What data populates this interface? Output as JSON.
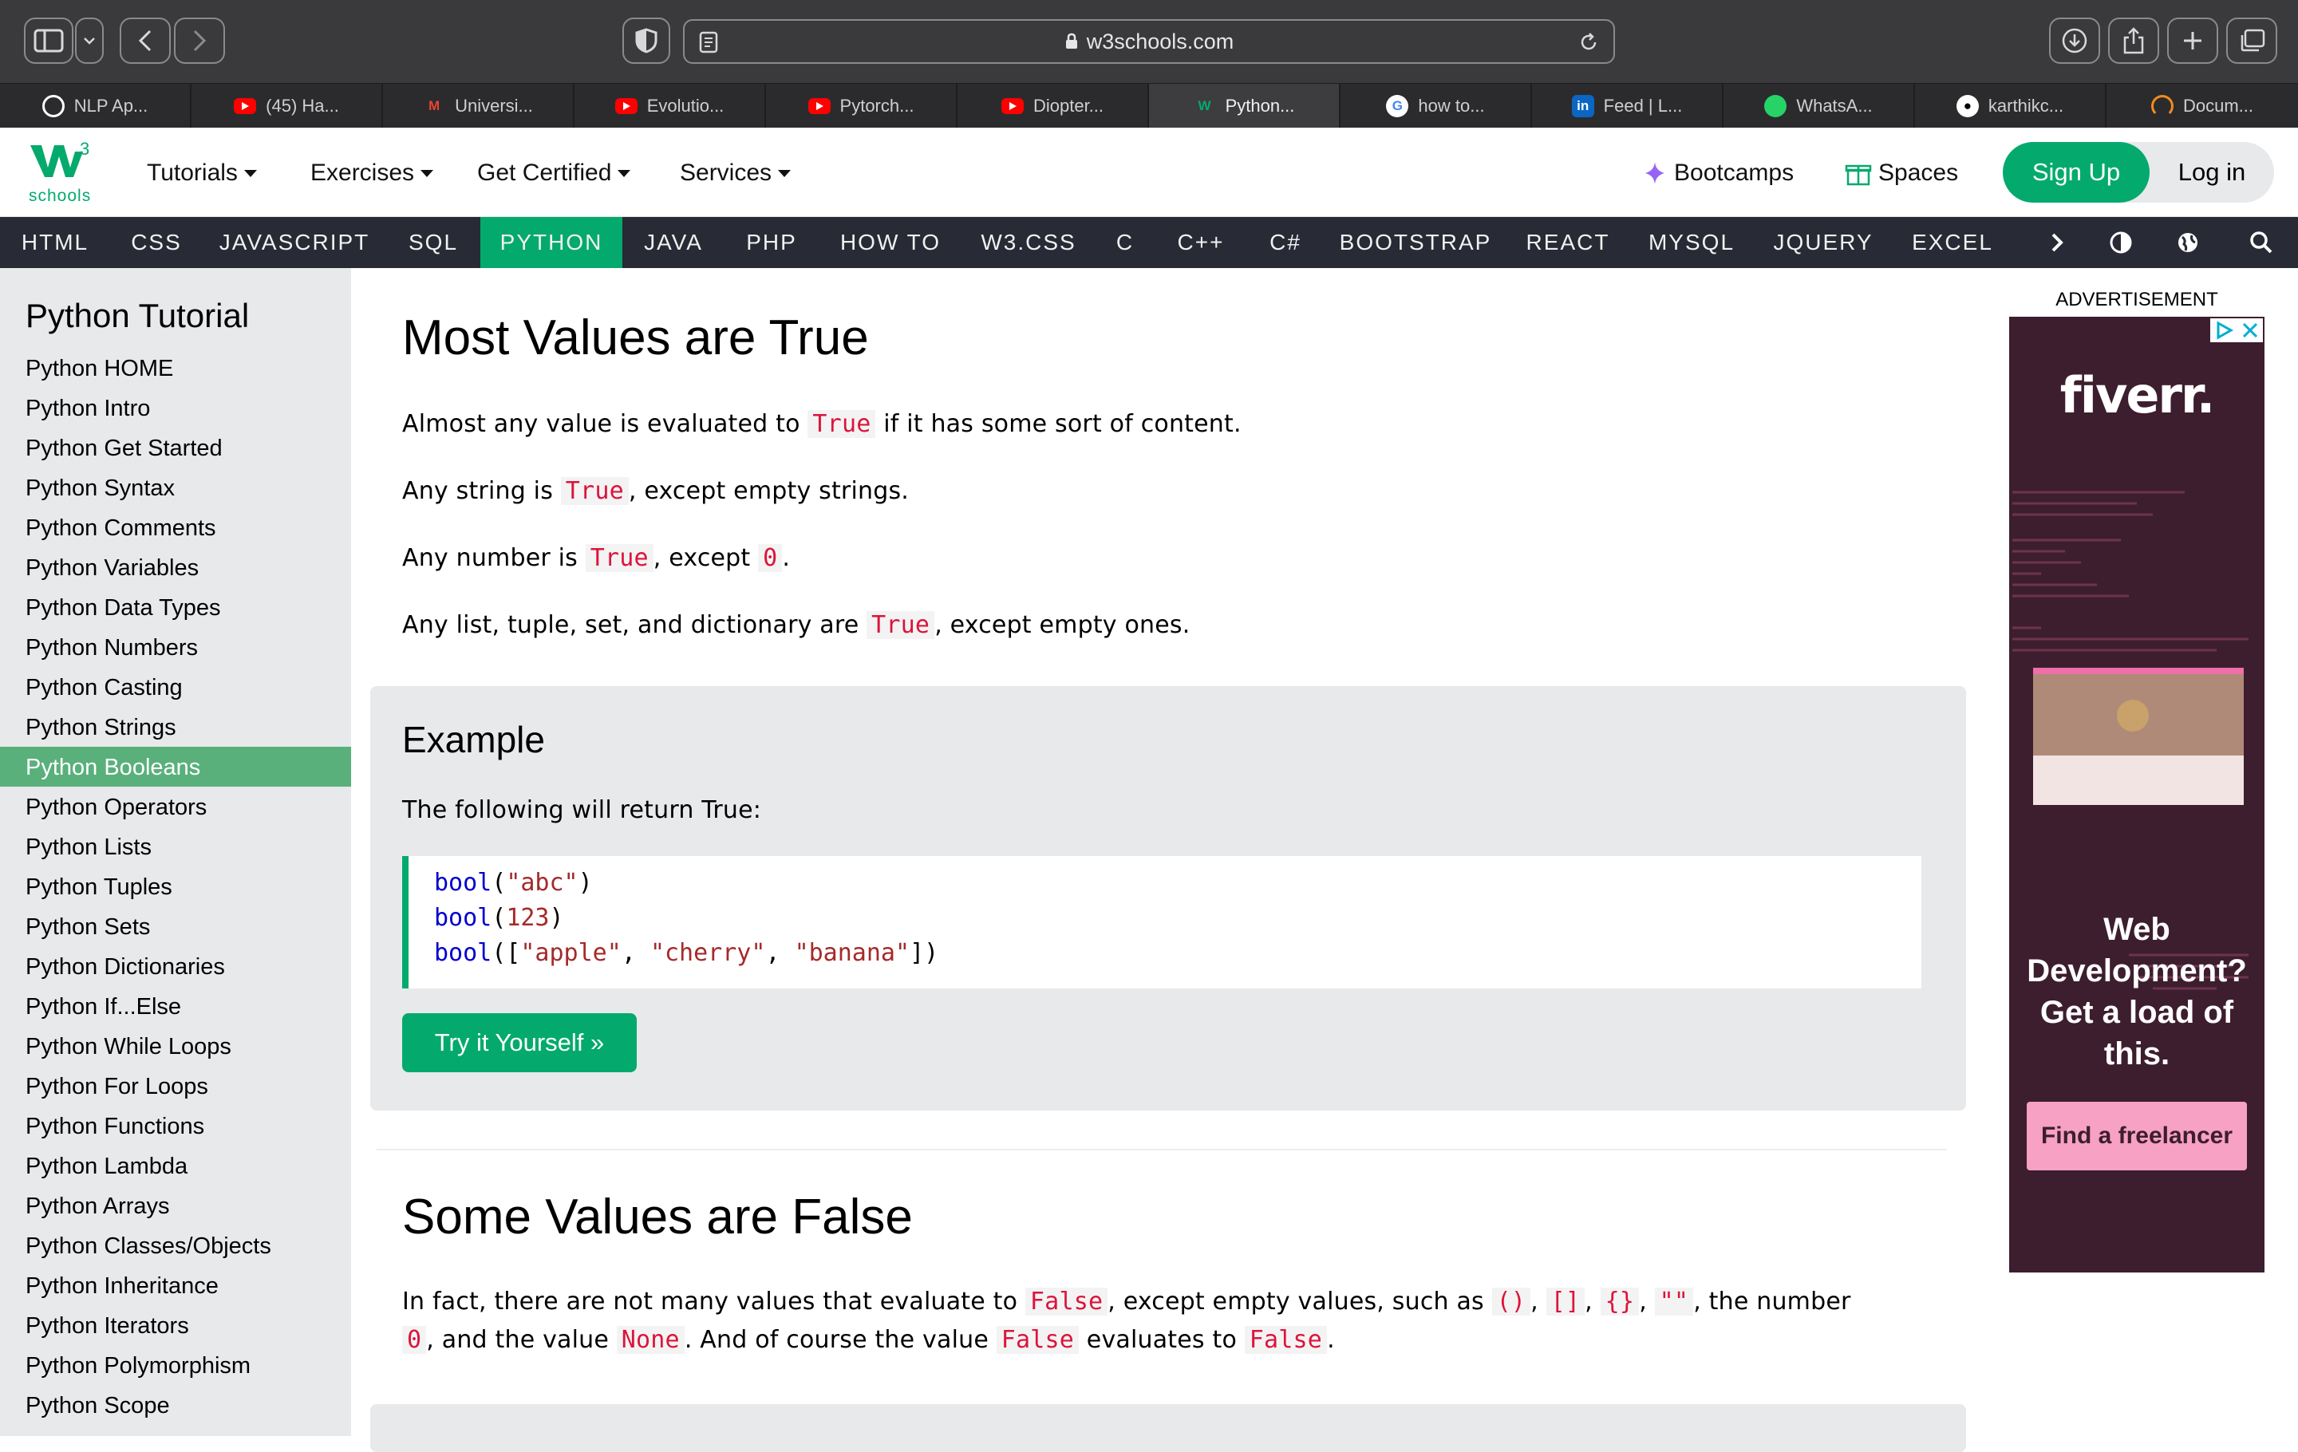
{
  "browser": {
    "url": "w3schools.com",
    "tabs": [
      {
        "label": "NLP Ap...",
        "icon": "openai-icon",
        "color": "#ffffff"
      },
      {
        "label": "(45) Ha...",
        "icon": "youtube-icon",
        "color": "#ff0000"
      },
      {
        "label": "Universi...",
        "icon": "gmail-icon",
        "color": "#ea4335"
      },
      {
        "label": "Evolutio...",
        "icon": "youtube-icon",
        "color": "#ff0000"
      },
      {
        "label": "Pytorch...",
        "icon": "youtube-icon",
        "color": "#ff0000"
      },
      {
        "label": "Diopter...",
        "icon": "youtube-icon",
        "color": "#ff0000"
      },
      {
        "label": "Python...",
        "icon": "w3schools-icon",
        "color": "#04aa6d",
        "active": true
      },
      {
        "label": "how to...",
        "icon": "google-icon",
        "color": "#4285f4"
      },
      {
        "label": "Feed | L...",
        "icon": "linkedin-icon",
        "color": "#0a66c2"
      },
      {
        "label": "WhatsA...",
        "icon": "whatsapp-icon",
        "color": "#25d366"
      },
      {
        "label": "karthikc...",
        "icon": "github-icon",
        "color": "#ffffff"
      },
      {
        "label": "Docum...",
        "icon": "loading-icon",
        "color": "#f28b20"
      }
    ]
  },
  "header": {
    "logo_sub": "schools",
    "logo_sup": "3",
    "menus": [
      "Tutorials",
      "Exercises",
      "Get Certified",
      "Services"
    ],
    "bootcamps": "Bootcamps",
    "spaces": "Spaces",
    "signup": "Sign Up",
    "login": "Log in"
  },
  "topnav": {
    "items": [
      "HTML",
      "CSS",
      "JAVASCRIPT",
      "SQL",
      "PYTHON",
      "JAVA",
      "PHP",
      "HOW TO",
      "W3.CSS",
      "C",
      "C++",
      "C#",
      "BOOTSTRAP",
      "REACT",
      "MYSQL",
      "JQUERY",
      "EXCEL"
    ],
    "active": "PYTHON"
  },
  "sidebar": {
    "title": "Python Tutorial",
    "items": [
      "Python HOME",
      "Python Intro",
      "Python Get Started",
      "Python Syntax",
      "Python Comments",
      "Python Variables",
      "Python Data Types",
      "Python Numbers",
      "Python Casting",
      "Python Strings",
      "Python Booleans",
      "Python Operators",
      "Python Lists",
      "Python Tuples",
      "Python Sets",
      "Python Dictionaries",
      "Python If...Else",
      "Python While Loops",
      "Python For Loops",
      "Python Functions",
      "Python Lambda",
      "Python Arrays",
      "Python Classes/Objects",
      "Python Inheritance",
      "Python Iterators",
      "Python Polymorphism",
      "Python Scope"
    ],
    "active": "Python Booleans"
  },
  "main": {
    "section1": {
      "heading": "Most Values are True",
      "p1": {
        "a": "Almost any value is evaluated to ",
        "code": "True",
        "b": " if it has some sort of content."
      },
      "p2": {
        "a": "Any string is ",
        "code": "True",
        "b": ", except empty strings."
      },
      "p3": {
        "a": "Any number is ",
        "code": "True",
        "b": ", except ",
        "code2": "0",
        "c": "."
      },
      "p4": {
        "a": "Any list, tuple, set, and dictionary are ",
        "code": "True",
        "b": ", except empty ones."
      }
    },
    "example": {
      "heading": "Example",
      "text": "The following will return True:",
      "code_lines": [
        [
          {
            "t": "bool",
            "c": "kw"
          },
          {
            "t": "(",
            "c": "pl"
          },
          {
            "t": "\"abc\"",
            "c": "st"
          },
          {
            "t": ")",
            "c": "pl"
          }
        ],
        [
          {
            "t": "bool",
            "c": "kw"
          },
          {
            "t": "(",
            "c": "pl"
          },
          {
            "t": "123",
            "c": "st"
          },
          {
            "t": ")",
            "c": "pl"
          }
        ],
        [
          {
            "t": "bool",
            "c": "kw"
          },
          {
            "t": "([",
            "c": "pl"
          },
          {
            "t": "\"apple\"",
            "c": "st"
          },
          {
            "t": ", ",
            "c": "pl"
          },
          {
            "t": "\"cherry\"",
            "c": "st"
          },
          {
            "t": ", ",
            "c": "pl"
          },
          {
            "t": "\"banana\"",
            "c": "st"
          },
          {
            "t": "])",
            "c": "pl"
          }
        ]
      ],
      "button": "Try it Yourself »"
    },
    "section2": {
      "heading": "Some Values are False",
      "line1": {
        "a": "In fact, there are not many values that evaluate to ",
        "code": "False",
        "b": ", except empty values, such as ",
        "c1": "()",
        "s1": ", ",
        "c2": "[]",
        "s2": ", ",
        "c3": "{}",
        "s3": ", ",
        "c4": "\"\"",
        "c": ", the number"
      },
      "line2": {
        "code0": "0",
        "a": ", and the value ",
        "code": "None",
        "b": ". And of course the value ",
        "code2": "False",
        "c": " evaluates to ",
        "code3": "False",
        "d": "."
      }
    }
  },
  "ad": {
    "label": "ADVERTISEMENT",
    "brand": "fiverr.",
    "headline": "Web Development? Get a load of this.",
    "cta": "Find a freelancer",
    "bg": "#3d1e2e",
    "cta_color": "#f7a1c4"
  },
  "colors": {
    "w3green": "#04aa6d",
    "darknav": "#282a35",
    "sidebar": "#e7e9eb"
  }
}
